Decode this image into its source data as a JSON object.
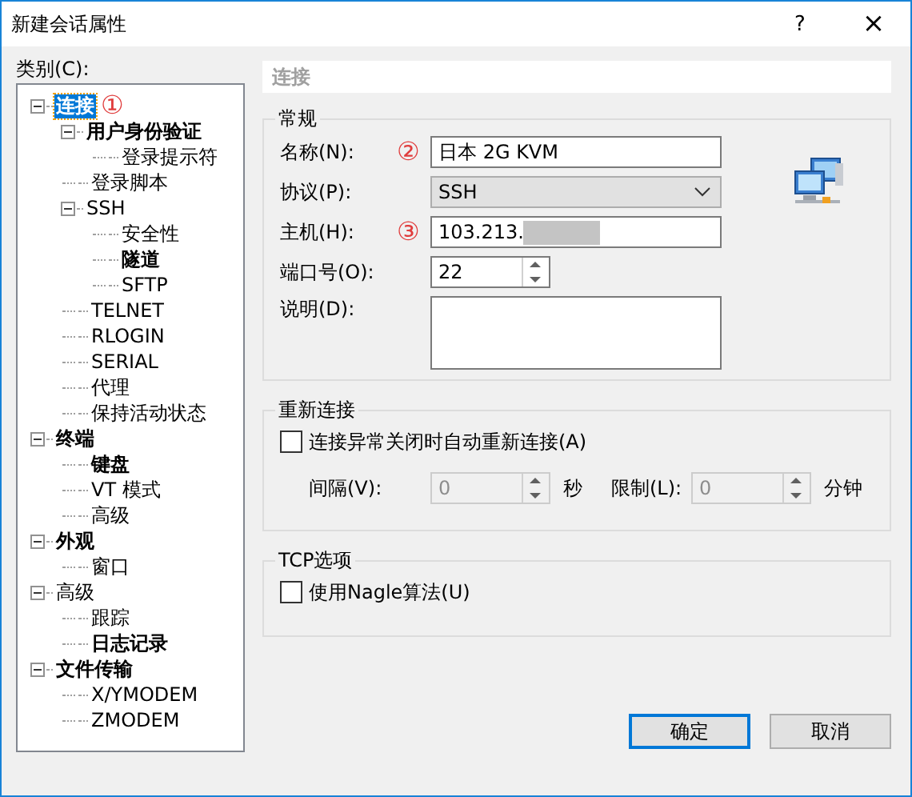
{
  "window": {
    "title": "新建会话属性",
    "help_button": "?",
    "close_button": "×"
  },
  "category_label": "类别(C):",
  "tree": [
    {
      "label": "连接",
      "bold": true,
      "selected": true,
      "expanded": true,
      "annotation": "①",
      "children": [
        {
          "label": "用户身份验证",
          "bold": true,
          "selected": false,
          "expanded": true,
          "children": [
            {
              "label": "登录提示符",
              "bold": false,
              "selected": false
            }
          ]
        },
        {
          "label": "登录脚本",
          "bold": false,
          "selected": false
        },
        {
          "label": "SSH",
          "bold": false,
          "selected": false,
          "expanded": true,
          "children": [
            {
              "label": "安全性",
              "bold": false,
              "selected": false
            },
            {
              "label": "隧道",
              "bold": true,
              "selected": false
            },
            {
              "label": "SFTP",
              "bold": false,
              "selected": false
            }
          ]
        },
        {
          "label": "TELNET",
          "bold": false,
          "selected": false
        },
        {
          "label": "RLOGIN",
          "bold": false,
          "selected": false
        },
        {
          "label": "SERIAL",
          "bold": false,
          "selected": false
        },
        {
          "label": "代理",
          "bold": false,
          "selected": false
        },
        {
          "label": "保持活动状态",
          "bold": false,
          "selected": false
        }
      ]
    },
    {
      "label": "终端",
      "bold": true,
      "selected": false,
      "expanded": true,
      "children": [
        {
          "label": "键盘",
          "bold": true,
          "selected": false
        },
        {
          "label": "VT 模式",
          "bold": false,
          "selected": false
        },
        {
          "label": "高级",
          "bold": false,
          "selected": false
        }
      ]
    },
    {
      "label": "外观",
      "bold": true,
      "selected": false,
      "expanded": true,
      "children": [
        {
          "label": "窗口",
          "bold": false,
          "selected": false
        }
      ]
    },
    {
      "label": "高级",
      "bold": false,
      "selected": false,
      "expanded": true,
      "children": [
        {
          "label": "跟踪",
          "bold": false,
          "selected": false
        },
        {
          "label": "日志记录",
          "bold": true,
          "selected": false
        }
      ]
    },
    {
      "label": "文件传输",
      "bold": true,
      "selected": false,
      "expanded": true,
      "children": [
        {
          "label": "X/YMODEM",
          "bold": false,
          "selected": false
        },
        {
          "label": "ZMODEM",
          "bold": false,
          "selected": false
        }
      ]
    }
  ],
  "panel_title": "连接",
  "general": {
    "title": "常规",
    "fields": [
      {
        "kind": "text",
        "label": "名称(N):",
        "annotation": "②",
        "value": "日本 2G KVM"
      },
      {
        "kind": "select",
        "label": "协议(P):",
        "value": "SSH"
      },
      {
        "kind": "text",
        "label": "主机(H):",
        "annotation": "③",
        "value": "103.213.",
        "redacted": true
      },
      {
        "kind": "spin",
        "label": "端口号(O):",
        "value": "22"
      },
      {
        "kind": "textarea",
        "label": "说明(D):"
      }
    ]
  },
  "reconnect": {
    "title": "重新连接",
    "checkbox": {
      "label": "连接异常关闭时自动重新连接(A)",
      "checked": false
    },
    "spins": [
      {
        "label": "间隔(V):",
        "value": "0",
        "unit": "秒",
        "disabled": true
      },
      {
        "label": "限制(L):",
        "value": "0",
        "unit": "分钟",
        "disabled": true
      }
    ]
  },
  "tcp": {
    "title": "TCP选项",
    "checkbox": {
      "label": "使用Nagle算法(U)",
      "checked": false
    }
  },
  "buttons": [
    {
      "label": "确定",
      "default": true
    },
    {
      "label": "取消",
      "default": false
    }
  ]
}
